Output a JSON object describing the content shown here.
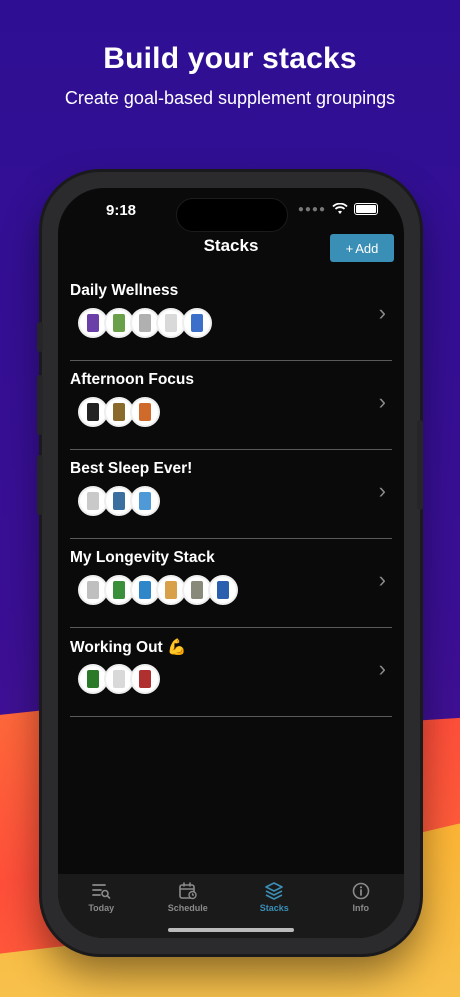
{
  "header": {
    "title": "Build your stacks",
    "subtitle": "Create goal-based supplement groupings"
  },
  "status_bar": {
    "time": "9:18"
  },
  "nav": {
    "title": "Stacks",
    "add_label": "Add",
    "add_icon": "+"
  },
  "stacks": [
    {
      "name": "Daily Wellness",
      "thumb_colors": [
        "#6b3fa8",
        "#6aa04a",
        "#b0b0b0",
        "#d9d9d9",
        "#3b6fc9"
      ]
    },
    {
      "name": "Afternoon Focus",
      "thumb_colors": [
        "#222222",
        "#8a6a2a",
        "#d06a2a"
      ]
    },
    {
      "name": "Best Sleep Ever!",
      "thumb_colors": [
        "#c9c9c9",
        "#3b6fa0",
        "#4f9ad6"
      ]
    },
    {
      "name": "My Longevity Stack",
      "thumb_colors": [
        "#bfbfbf",
        "#3a8f3a",
        "#2f86c9",
        "#d9a04a",
        "#8a8a7a",
        "#2a5fb0"
      ]
    },
    {
      "name": "Working Out 💪",
      "thumb_colors": [
        "#2a7a2a",
        "#d9d9d9",
        "#b03030"
      ]
    }
  ],
  "tabs": [
    {
      "label": "Today",
      "icon": "today-icon",
      "active": false
    },
    {
      "label": "Schedule",
      "icon": "schedule-icon",
      "active": false
    },
    {
      "label": "Stacks",
      "icon": "stacks-icon",
      "active": true
    },
    {
      "label": "Info",
      "icon": "info-icon",
      "active": false
    }
  ],
  "colors": {
    "accent": "#3a8fb7",
    "background_top": "#2e0f93",
    "screen_bg": "#0a0a0a"
  }
}
